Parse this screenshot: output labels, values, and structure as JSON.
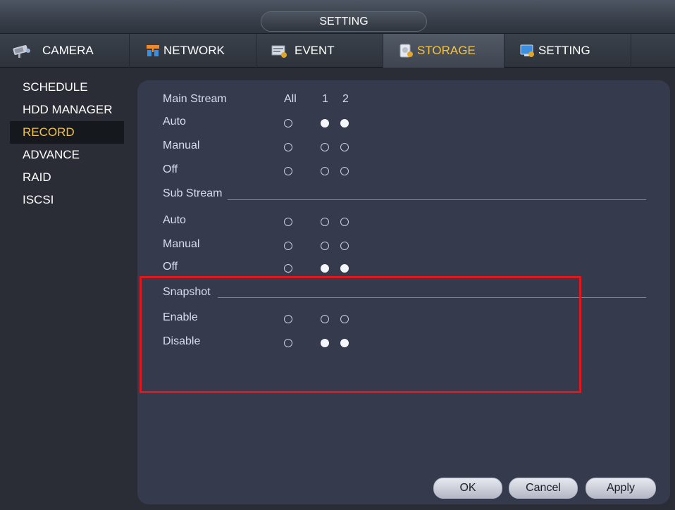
{
  "window": {
    "title": "SETTING"
  },
  "tabs": [
    {
      "label": "CAMERA",
      "icon": "camera-icon"
    },
    {
      "label": "NETWORK",
      "icon": "network-icon"
    },
    {
      "label": "EVENT",
      "icon": "event-icon"
    },
    {
      "label": "STORAGE",
      "icon": "storage-icon",
      "active": true
    },
    {
      "label": "SETTING",
      "icon": "setting-icon"
    }
  ],
  "sidebar": {
    "items": [
      {
        "label": "SCHEDULE"
      },
      {
        "label": "HDD MANAGER"
      },
      {
        "label": "RECORD",
        "active": true
      },
      {
        "label": "ADVANCE"
      },
      {
        "label": "RAID"
      },
      {
        "label": "ISCSI"
      }
    ]
  },
  "record": {
    "main_stream": {
      "label": "Main Stream",
      "col_all": "All",
      "col_1": "1",
      "col_2": "2",
      "rows": [
        {
          "label": "Auto",
          "all": false,
          "ch1": true,
          "ch2": true
        },
        {
          "label": "Manual",
          "all": false,
          "ch1": false,
          "ch2": false
        },
        {
          "label": "Off",
          "all": false,
          "ch1": false,
          "ch2": false
        }
      ]
    },
    "sub_stream": {
      "label": "Sub Stream",
      "rows": [
        {
          "label": "Auto",
          "all": false,
          "ch1": false,
          "ch2": false
        },
        {
          "label": "Manual",
          "all": false,
          "ch1": false,
          "ch2": false
        },
        {
          "label": "Off",
          "all": false,
          "ch1": true,
          "ch2": true
        }
      ]
    },
    "snapshot": {
      "label": "Snapshot",
      "rows": [
        {
          "label": "Enable",
          "all": false,
          "ch1": false,
          "ch2": false
        },
        {
          "label": "Disable",
          "all": false,
          "ch1": true,
          "ch2": true
        }
      ]
    }
  },
  "buttons": {
    "ok": "OK",
    "cancel": "Cancel",
    "apply": "Apply"
  },
  "colors": {
    "accent": "#f5c342",
    "highlight": "#e6141b",
    "panel": "#353a4c"
  }
}
